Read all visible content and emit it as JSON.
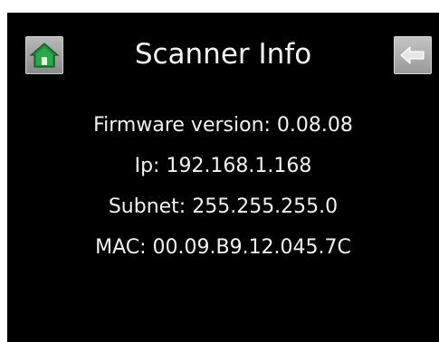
{
  "screen": {
    "title": "Scanner Info",
    "home_button": {
      "icon": "home-icon"
    },
    "back_button": {
      "icon": "back-arrow-icon"
    },
    "info": [
      "Firmware version: 0.08.08",
      "Ip: 192.168.1.168",
      "Subnet: 255.255.255.0",
      "MAC: 00.09.B9.12.045.7C"
    ]
  },
  "colors": {
    "background": "#000000",
    "text": "#ffffff",
    "home_icon_green": "#1e8a3a",
    "button_gray": "#a8a8a8"
  }
}
